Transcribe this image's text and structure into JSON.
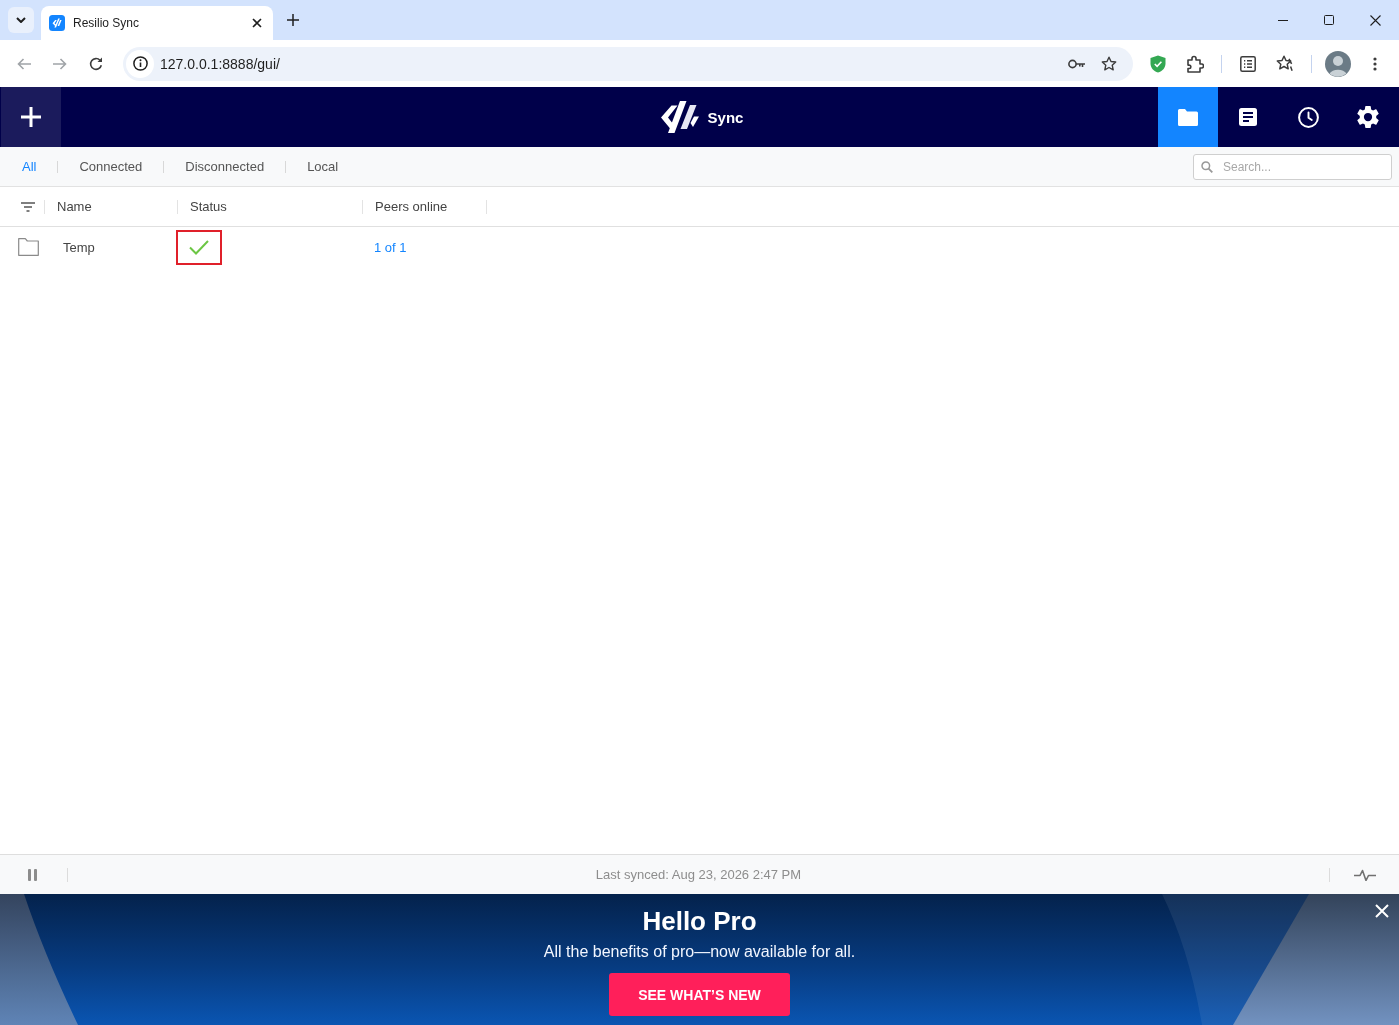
{
  "browser": {
    "tab": {
      "title": "Resilio Sync"
    },
    "url": "127.0.0.1:8888/gui/"
  },
  "header": {
    "brand": "Sync",
    "nav": [
      {
        "kind": "folders",
        "selected": true
      },
      {
        "kind": "log",
        "selected": false
      },
      {
        "kind": "history",
        "selected": false
      },
      {
        "kind": "settings",
        "selected": false
      }
    ]
  },
  "filters": {
    "tabs": [
      {
        "label": "All",
        "selected": true
      },
      {
        "label": "Connected",
        "selected": false
      },
      {
        "label": "Disconnected",
        "selected": false
      },
      {
        "label": "Local",
        "selected": false
      }
    ],
    "search": {
      "placeholder": "Search..."
    }
  },
  "table": {
    "columns": [
      "Name",
      "Status",
      "Peers online"
    ],
    "rows": [
      {
        "name": "Temp",
        "synced": true,
        "highlighted": true,
        "peers_online": "1 of 1"
      }
    ]
  },
  "status_bar": {
    "text": "Last synced: Aug 23, 2026 2:47 PM"
  },
  "banner": {
    "title": "Hello Pro",
    "subtitle": "All the benefits of pro—now available for all.",
    "button": "SEE WHAT’S NEW"
  }
}
